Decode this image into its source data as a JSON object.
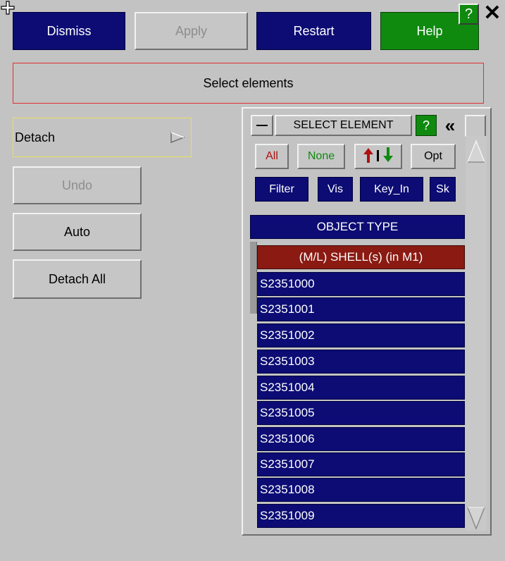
{
  "toolbar": {
    "dismiss": "Dismiss",
    "apply": "Apply",
    "restart": "Restart",
    "help": "Help",
    "help_question": "?",
    "close": "✕"
  },
  "message": "Select elements",
  "left_panel": {
    "detach": "Detach",
    "undo": "Undo",
    "auto": "Auto",
    "detach_all": "Detach All"
  },
  "select_panel": {
    "title": "SELECT ELEMENT",
    "help_question": "?",
    "collapse": "«",
    "buttons": {
      "all": "All",
      "none": "None",
      "opt": "Opt",
      "filter": "Filter",
      "vis": "Vis",
      "key_in": "Key_In",
      "sk": "Sk"
    },
    "object_type": "OBJECT TYPE",
    "shell_header": "(M/L) SHELL(s) (in M1)",
    "items": [
      "S2351000",
      "S2351001",
      "S2351002",
      "S2351003",
      "S2351004",
      "S2351005",
      "S2351006",
      "S2351007",
      "S2351008",
      "S2351009"
    ]
  },
  "colors": {
    "navy": "#0c0c74",
    "help_green": "#0f8a0f",
    "header_red": "#8a1a12",
    "all_red": "#b01010",
    "none_green": "#108a10"
  }
}
